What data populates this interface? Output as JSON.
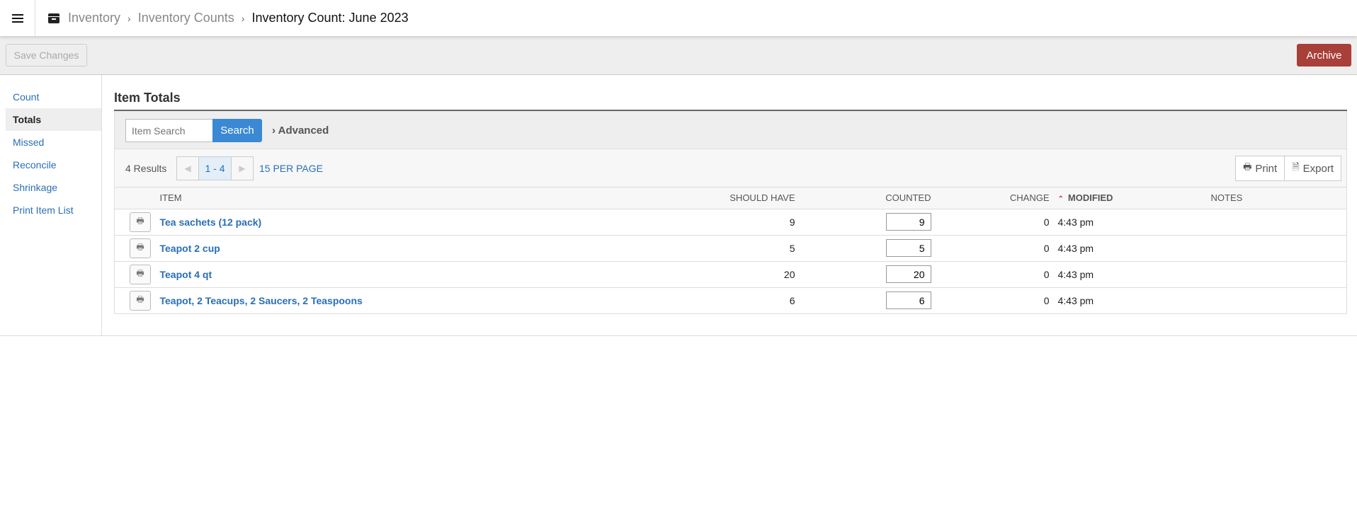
{
  "header": {
    "breadcrumbs": [
      "Inventory",
      "Inventory Counts",
      "Inventory Count: June 2023"
    ]
  },
  "toolbar": {
    "save_label": "Save Changes",
    "archive_label": "Archive",
    "archive_color": "#a83f39"
  },
  "sidebar": {
    "items": [
      {
        "label": "Count"
      },
      {
        "label": "Totals",
        "active": true
      },
      {
        "label": "Missed"
      },
      {
        "label": "Reconcile"
      },
      {
        "label": "Shrinkage"
      },
      {
        "label": "Print Item List"
      }
    ]
  },
  "main": {
    "title": "Item Totals",
    "search": {
      "placeholder": "Item Search",
      "button": "Search",
      "advanced": "Advanced"
    },
    "results": "4 Results",
    "page_range": "1 - 4",
    "per_page": "15 PER PAGE",
    "print_label": "Print",
    "export_label": "Export",
    "columns": {
      "item": "ITEM",
      "should_have": "SHOULD HAVE",
      "counted": "COUNTED",
      "change": "CHANGE",
      "modified": "MODIFIED",
      "notes": "NOTES"
    },
    "rows": [
      {
        "item": "Tea sachets (12 pack)",
        "should_have": "9",
        "counted": "9",
        "change": "0",
        "modified": "4:43 pm",
        "notes": ""
      },
      {
        "item": "Teapot 2 cup",
        "should_have": "5",
        "counted": "5",
        "change": "0",
        "modified": "4:43 pm",
        "notes": ""
      },
      {
        "item": "Teapot 4 qt",
        "should_have": "20",
        "counted": "20",
        "change": "0",
        "modified": "4:43 pm",
        "notes": ""
      },
      {
        "item": "Teapot, 2 Teacups, 2 Saucers, 2 Teaspoons",
        "should_have": "6",
        "counted": "6",
        "change": "0",
        "modified": "4:43 pm",
        "notes": ""
      }
    ]
  }
}
